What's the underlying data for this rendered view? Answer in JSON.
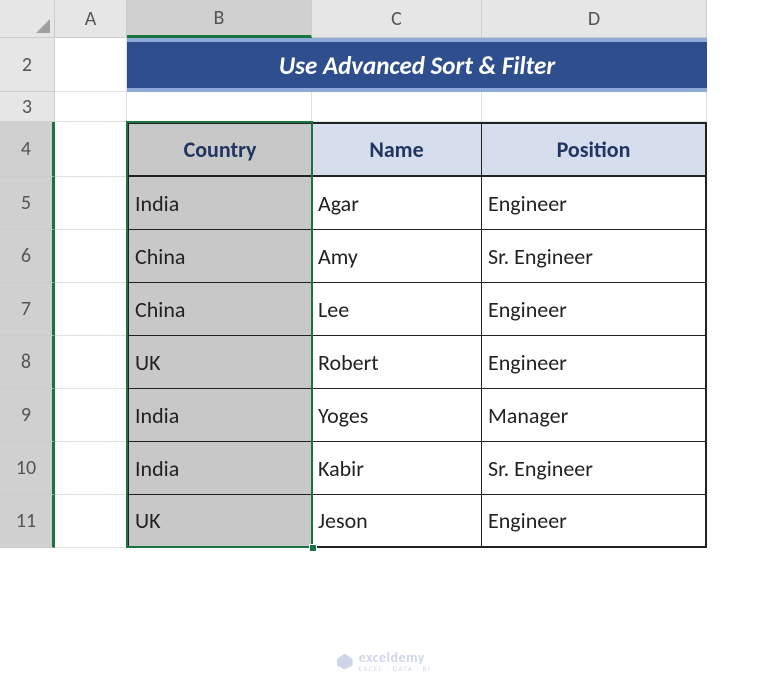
{
  "columns": [
    "A",
    "B",
    "C",
    "D"
  ],
  "rows": [
    "2",
    "3",
    "4",
    "5",
    "6",
    "7",
    "8",
    "9",
    "10",
    "11"
  ],
  "title": "Use Advanced Sort & Filter",
  "headers": {
    "country": "Country",
    "name": "Name",
    "position": "Position"
  },
  "chart_data": {
    "type": "table",
    "title": "Use Advanced Sort & Filter",
    "columns": [
      "Country",
      "Name",
      "Position"
    ],
    "rows": [
      {
        "country": "India",
        "name": "Agar",
        "position": "Engineer"
      },
      {
        "country": "China",
        "name": "Amy",
        "position": "Sr. Engineer"
      },
      {
        "country": "China",
        "name": "Lee",
        "position": "Engineer"
      },
      {
        "country": "UK",
        "name": "Robert",
        "position": "Engineer"
      },
      {
        "country": "India",
        "name": "Yoges",
        "position": "Manager"
      },
      {
        "country": "India",
        "name": "Kabir",
        "position": "Sr. Engineer"
      },
      {
        "country": "UK",
        "name": "Jeson",
        "position": "Engineer"
      }
    ]
  },
  "watermark": {
    "main": "exceldemy",
    "sub": "EXCEL · DATA · BI"
  }
}
